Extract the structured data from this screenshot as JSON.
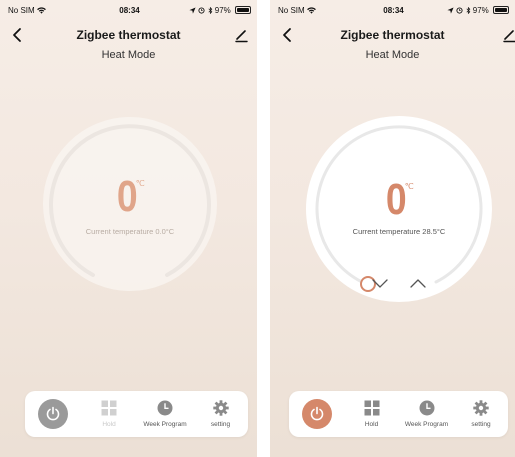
{
  "screens": [
    {
      "status": {
        "carrier": "No SIM",
        "time": "08:34",
        "battery": "97%",
        "battery_level": 0.97
      },
      "title": "Zigbee thermostat",
      "mode": "Heat Mode",
      "setpoint": "0",
      "unit": "℃",
      "current_label": "Current temperature 0.0°C",
      "power_active": false,
      "tabs": [
        {
          "label": "",
          "icon": "power-icon"
        },
        {
          "label": "Hold",
          "icon": "grid-icon",
          "disabled": true
        },
        {
          "label": "Week Program",
          "icon": "clock-icon"
        },
        {
          "label": "setting",
          "icon": "gear-icon"
        }
      ]
    },
    {
      "status": {
        "carrier": "No SIM",
        "time": "08:34",
        "battery": "97%",
        "battery_level": 0.97
      },
      "title": "Zigbee thermostat",
      "mode": "Heat Mode",
      "setpoint": "0",
      "unit": "℃",
      "current_label": "Current temperature 28.5°C",
      "power_active": true,
      "tabs": [
        {
          "label": "",
          "icon": "power-icon"
        },
        {
          "label": "Hold",
          "icon": "grid-icon",
          "disabled": false
        },
        {
          "label": "Week Program",
          "icon": "clock-icon"
        },
        {
          "label": "setting",
          "icon": "gear-icon"
        }
      ]
    }
  ],
  "colors": {
    "accent": "#d5886a",
    "power_inactive": "#9a9a9a",
    "icon_gray": "#8a8a8a",
    "icon_disabled": "#d0d0d0"
  }
}
